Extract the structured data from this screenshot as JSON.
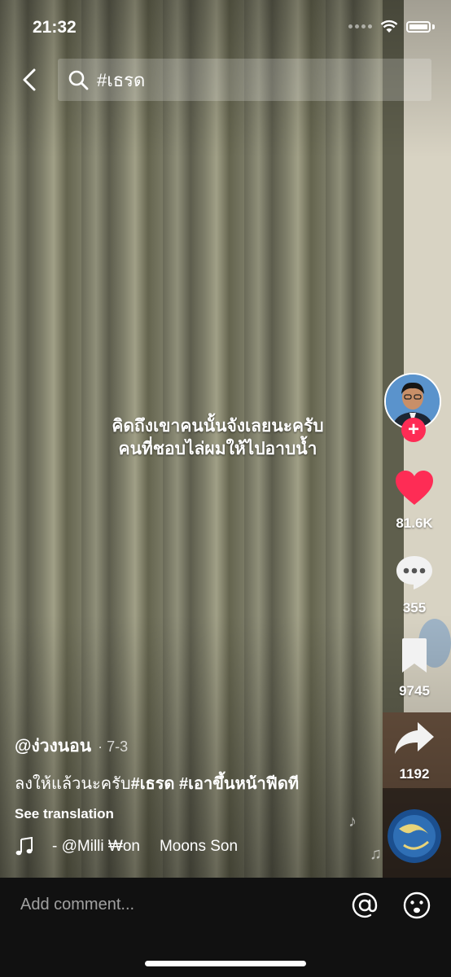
{
  "status_bar": {
    "time": "21:32"
  },
  "search": {
    "query": "#เธรด"
  },
  "video": {
    "caption_line1": "คิดถึงเขาคนนั้นจังเลยนะครับ",
    "caption_line2": "คนที่ชอบไล่ผมให้ไปอาบน้ำ"
  },
  "actions": {
    "likes": "81.6K",
    "comments": "355",
    "saves": "9745",
    "shares": "1192"
  },
  "post": {
    "username": "@ง่วงนอน",
    "date": "· 7-3",
    "description_text": "ลงให้แล้วนะครับ",
    "hashtag1": "#เธรด",
    "hashtag2": "#เอาขึ้นหน้าฟีดที",
    "see_translation": "See translation",
    "music_artist": "- @Milli ₩on",
    "music_title": "Moons Son"
  },
  "bottom": {
    "comment_placeholder": "Add comment..."
  },
  "colors": {
    "like_red": "#fe2c55",
    "follow_red": "#fe2c55",
    "bottom_bar": "#111111"
  },
  "icons": [
    "back-arrow-icon",
    "search-icon",
    "heart-icon",
    "comment-bubble-icon",
    "bookmark-icon",
    "share-arrow-icon",
    "music-note-icon",
    "at-sign-icon",
    "emoji-icon",
    "wifi-icon",
    "battery-icon",
    "plus-icon"
  ]
}
